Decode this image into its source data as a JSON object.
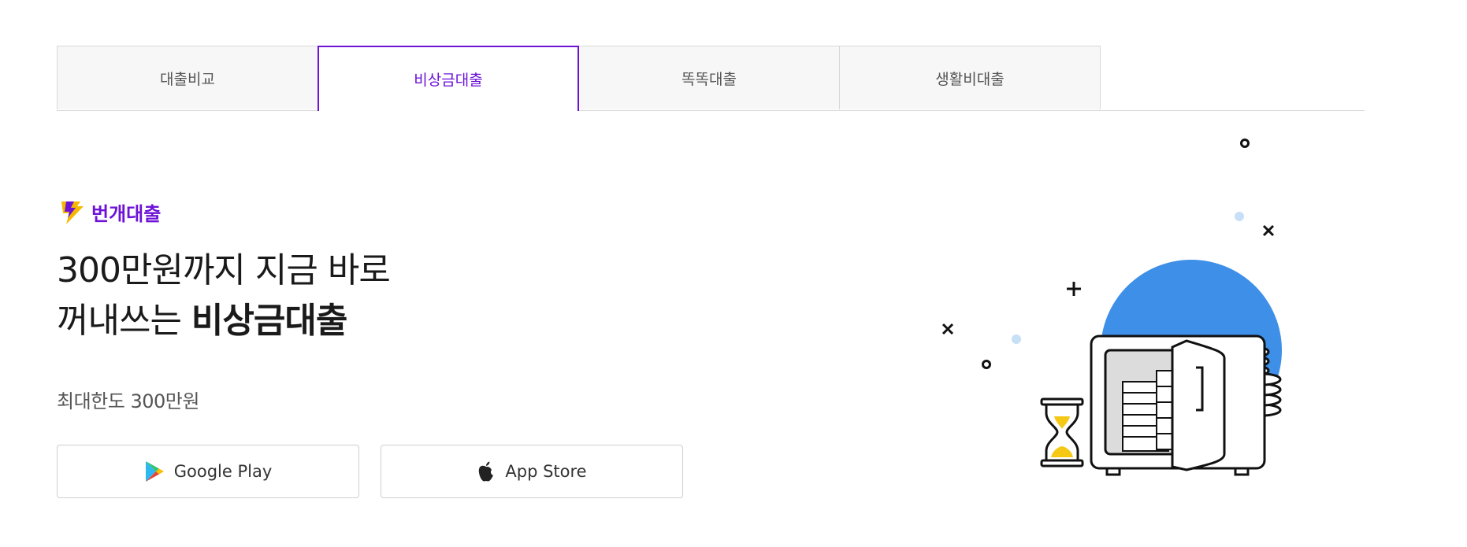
{
  "tabs": [
    {
      "label": "대출비교",
      "active": false
    },
    {
      "label": "비상금대출",
      "active": true
    },
    {
      "label": "똑똑대출",
      "active": false
    },
    {
      "label": "생활비대출",
      "active": false
    }
  ],
  "brand": {
    "name": "번개대출",
    "icon": "lightning-icon",
    "color": "#6d12d6"
  },
  "headline": {
    "line1": "300만원까지 지금 바로",
    "line2_prefix": "꺼내쓰는 ",
    "line2_strong": "비상금대출"
  },
  "limit_text": "최대한도 300만원",
  "store_buttons": {
    "google": {
      "label": "Google Play",
      "icon": "google-play-icon"
    },
    "apple": {
      "label": "App Store",
      "icon": "apple-icon"
    }
  },
  "illustration": {
    "name": "safe-illustration",
    "circle_color": "#3d8fe8",
    "sand_color": "#f5c816"
  }
}
